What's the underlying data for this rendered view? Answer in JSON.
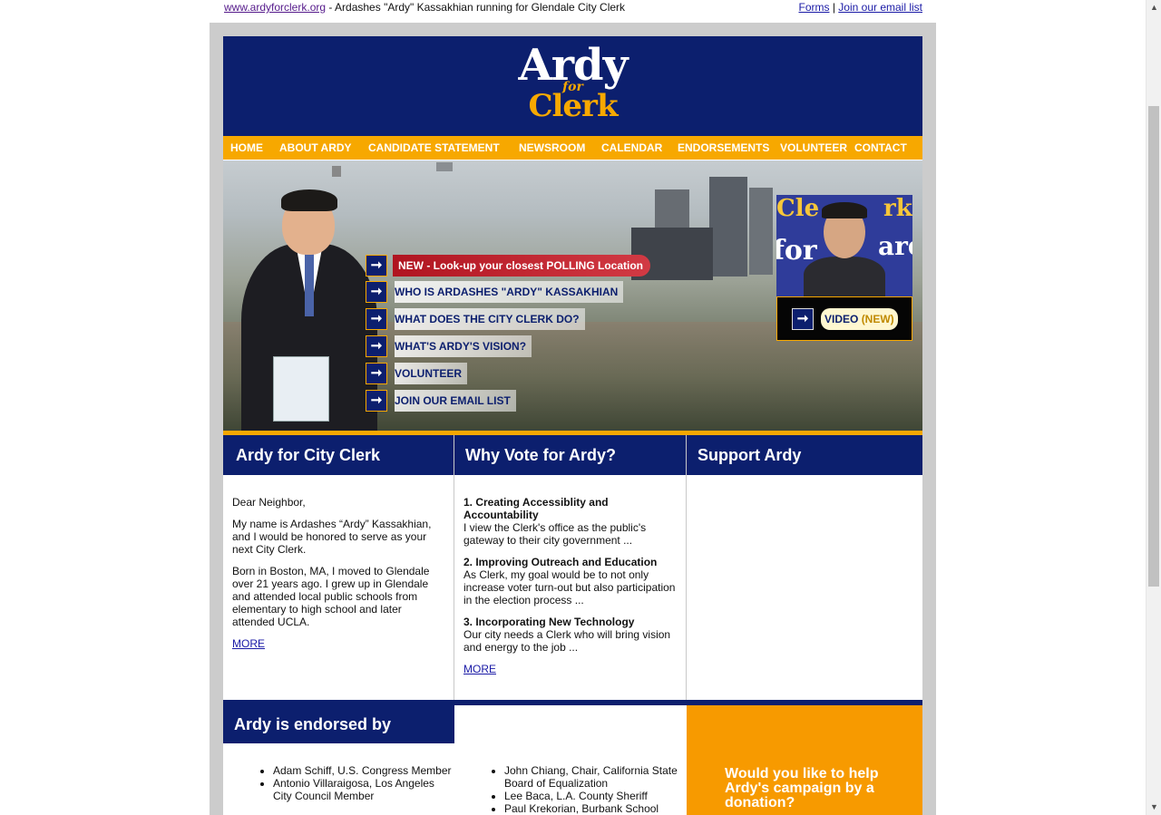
{
  "topbar": {
    "site_link": "www.ardyforclerk.org",
    "tagline": " - Ardashes \"Ardy\" Kassakhian running for Glendale City Clerk",
    "forms_link": "Forms",
    "separator": " | ",
    "email_link": "Join our email list"
  },
  "logo": {
    "line1": "Ardy",
    "line2": "for",
    "line3": "Clerk"
  },
  "nav": [
    "HOME",
    "ABOUT ARDY",
    "CANDIDATE STATEMENT",
    "NEWSROOM",
    "CALENDAR",
    "ENDORSEMENTS",
    "VOLUNTEER",
    "CONTACT"
  ],
  "hero": {
    "links": [
      "NEW - Look-up your closest POLLING Location",
      "WHO IS ARDASHES \"ARDY\" KASSAKHIAN",
      "WHAT DOES THE CITY CLERK DO?",
      "WHAT'S ARDY'S VISION?",
      "VOLUNTEER",
      "JOIN OUR EMAIL LIST"
    ],
    "arrow_glyph": "➞",
    "video_label": "VIDEO",
    "video_new": "(NEW)",
    "sign_word1": "Cle",
    "sign_word2": "rk",
    "sign_word3": "ardy",
    "sign_word4": "for"
  },
  "col1": {
    "title": "Ardy for City Clerk",
    "greeting": "Dear Neighbor,",
    "p1": "My name is Ardashes “Ardy” Kassakhian, and I would be honored to serve as your next City Clerk.",
    "p2": "Born in Boston, MA, I moved to Glendale over 21 years ago. I grew up in Glendale and attended local public schools from elementary to high school and later attended UCLA.",
    "more": "MORE"
  },
  "col2": {
    "title": "Why Vote for Ardy?",
    "items": [
      {
        "heading": "1. Creating Accessiblity and Accountability",
        "text": "I view the Clerk's office as the public's gateway to their city government ..."
      },
      {
        "heading": "2. Improving Outreach and Education",
        "text": "As Clerk, my goal would be to not only increase voter turn-out but also participation in the election process ..."
      },
      {
        "heading": "3. Incorporating New Technology",
        "text": "Our city needs a Clerk who will bring vision and energy to the job ..."
      }
    ],
    "more": "MORE"
  },
  "col3": {
    "title": "Support Ardy"
  },
  "endorsements": {
    "title": "Ardy is endorsed by",
    "left": [
      "Adam Schiff, U.S. Congress Member",
      "Antonio Villaraigosa, Los Angeles City Council Member"
    ],
    "right": [
      "John Chiang, Chair, California State Board of Equalization",
      "Lee Baca, L.A. County Sheriff",
      "Paul Krekorian, Burbank School"
    ]
  },
  "donate": {
    "question": "Would you like to help Ardy's campaign by a donation?"
  },
  "colors": {
    "navy": "#0c1f6e",
    "gold": "#f7a800",
    "orange": "#f79a00",
    "frame_grey": "#cccccc"
  },
  "scrollbar": {
    "up": "▲",
    "down": "▼"
  }
}
